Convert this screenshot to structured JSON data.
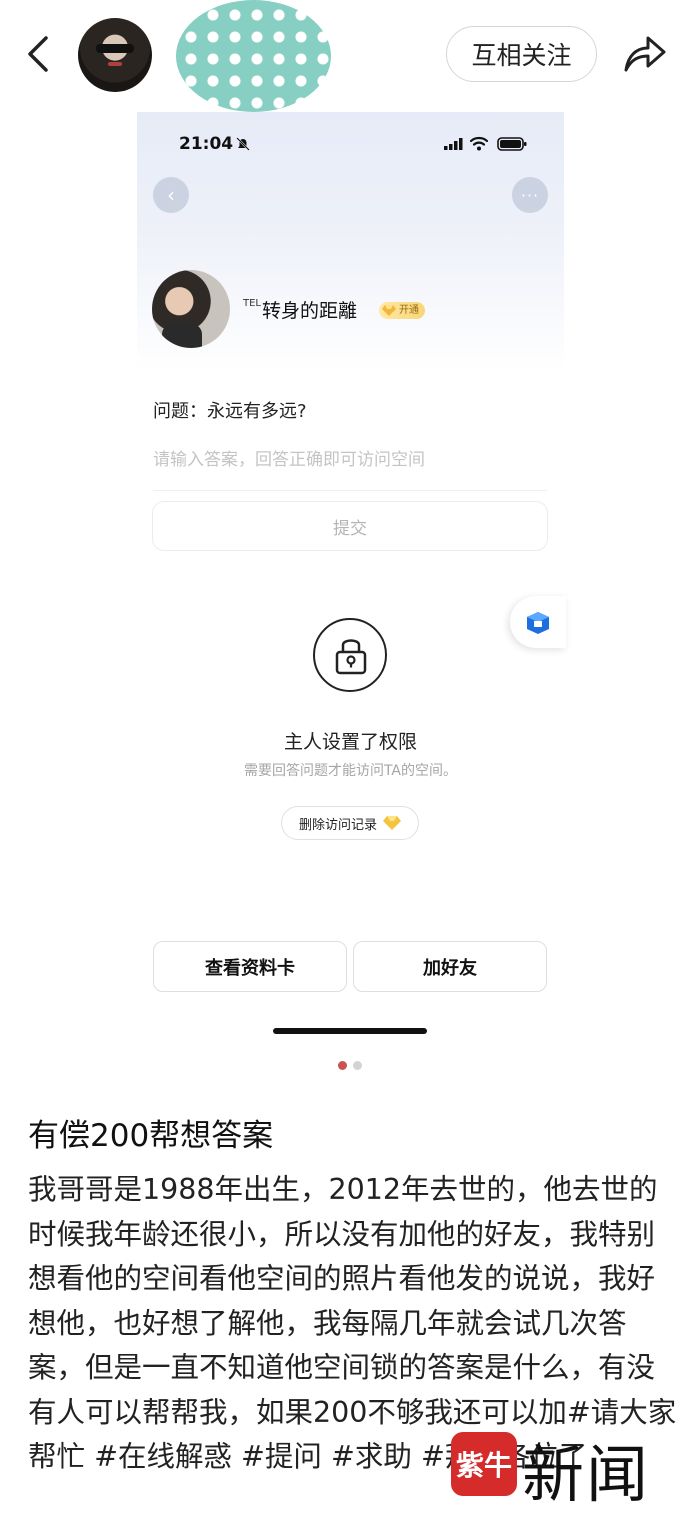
{
  "header": {
    "follow_label": "互相关注",
    "icons": [
      "chevron-left-icon",
      "share-icon"
    ]
  },
  "screenshot": {
    "status_time": "21:04",
    "owner_name_prefix": "TEL",
    "owner_name": "转身的距離",
    "vip_badge": "开通",
    "question": "问题：永远有多远?",
    "answer_placeholder": "请输入答案，回答正确即可访问空间",
    "submit_label": "提交",
    "permission_title": "主人设置了权限",
    "permission_subtitle": "需要回答问题才能访问TA的空间。",
    "delete_record_label": "删除访问记录",
    "view_card_label": "查看资料卡",
    "add_friend_label": "加好友"
  },
  "carousel": {
    "current": 1,
    "total": 2
  },
  "post": {
    "title": "有偿200帮想答案",
    "body": "我哥哥是1988年出生，2012年去世的，他去世的时候我年龄还很小，所以没有加他的好友，我特别想看他的空间看他空间的照片看他发的说说，我好想他，也好想了解他，我每隔几年就会试几次答案，但是一直不知道他空间锁的答案是什么，有没有人可以帮帮我，如果200不够我还可以加",
    "tags": [
      "#请大家帮忙",
      "#在线解惑",
      "#提问",
      "#求助",
      "#拜托各位了"
    ]
  },
  "watermark": {
    "seal_text": "紫牛",
    "text": "新闻"
  },
  "colors": {
    "accent_dot": "#c8534f",
    "vip_gold": "#f7d675",
    "watermark_red": "#d62b2b"
  }
}
